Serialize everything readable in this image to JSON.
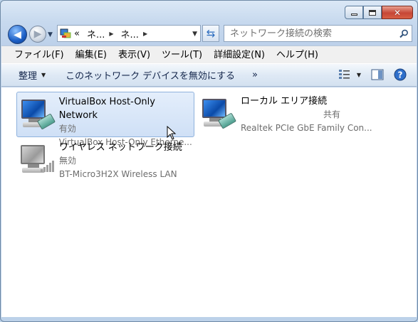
{
  "window": {
    "caption": {
      "minimize": "minimize",
      "maximize": "maximize",
      "close": "close"
    }
  },
  "nav": {
    "address_chevron": "«",
    "segments": [
      "ネ...",
      "ネ..."
    ]
  },
  "search": {
    "placeholder": "ネットワーク接続の検索"
  },
  "menu": [
    "ファイル(F)",
    "編集(E)",
    "表示(V)",
    "ツール(T)",
    "詳細設定(N)",
    "ヘルプ(H)"
  ],
  "toolbar": {
    "organize_label": "整理",
    "disable_label": "このネットワーク デバイスを無効にする",
    "more_label": "»"
  },
  "connections": [
    {
      "name": "VirtualBox Host-Only Network",
      "status": "有効",
      "device": "VirtualBox Host-Only Etherne...",
      "selected": true
    },
    {
      "name": "ローカル エリア接続",
      "status": "共有",
      "device": "Realtek PCIe GbE Family Con...",
      "selected": false
    },
    {
      "name": "ワイヤレス ネットワーク接続",
      "status": "無効",
      "device": "BT-Micro3H2X Wireless LAN",
      "selected": false
    }
  ]
}
